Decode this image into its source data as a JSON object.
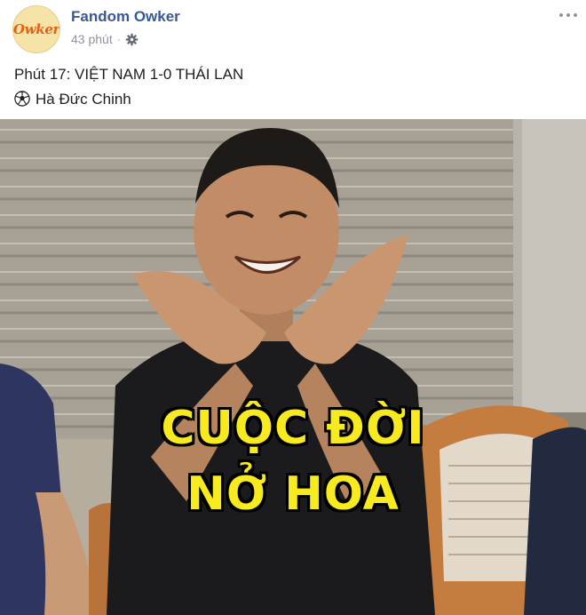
{
  "post": {
    "avatar_text": "Owker",
    "page_name": "Fandom Owker",
    "time": "43 phút",
    "separator": "·",
    "privacy_icon": "gear-icon",
    "caption_line1": "Phút 17: VIỆT NAM 1-0 THÁI LAN",
    "caption_line2_icon": "soccer-ball-icon",
    "caption_line2": "Hà Đức Chinh"
  },
  "photo": {
    "meme_line1": "CUỘC ĐỜI",
    "meme_line2": "NỞ HOA"
  },
  "colors": {
    "link_blue": "#385898",
    "meta_gray": "#90949c",
    "meme_yellow": "#f7ea1f"
  }
}
